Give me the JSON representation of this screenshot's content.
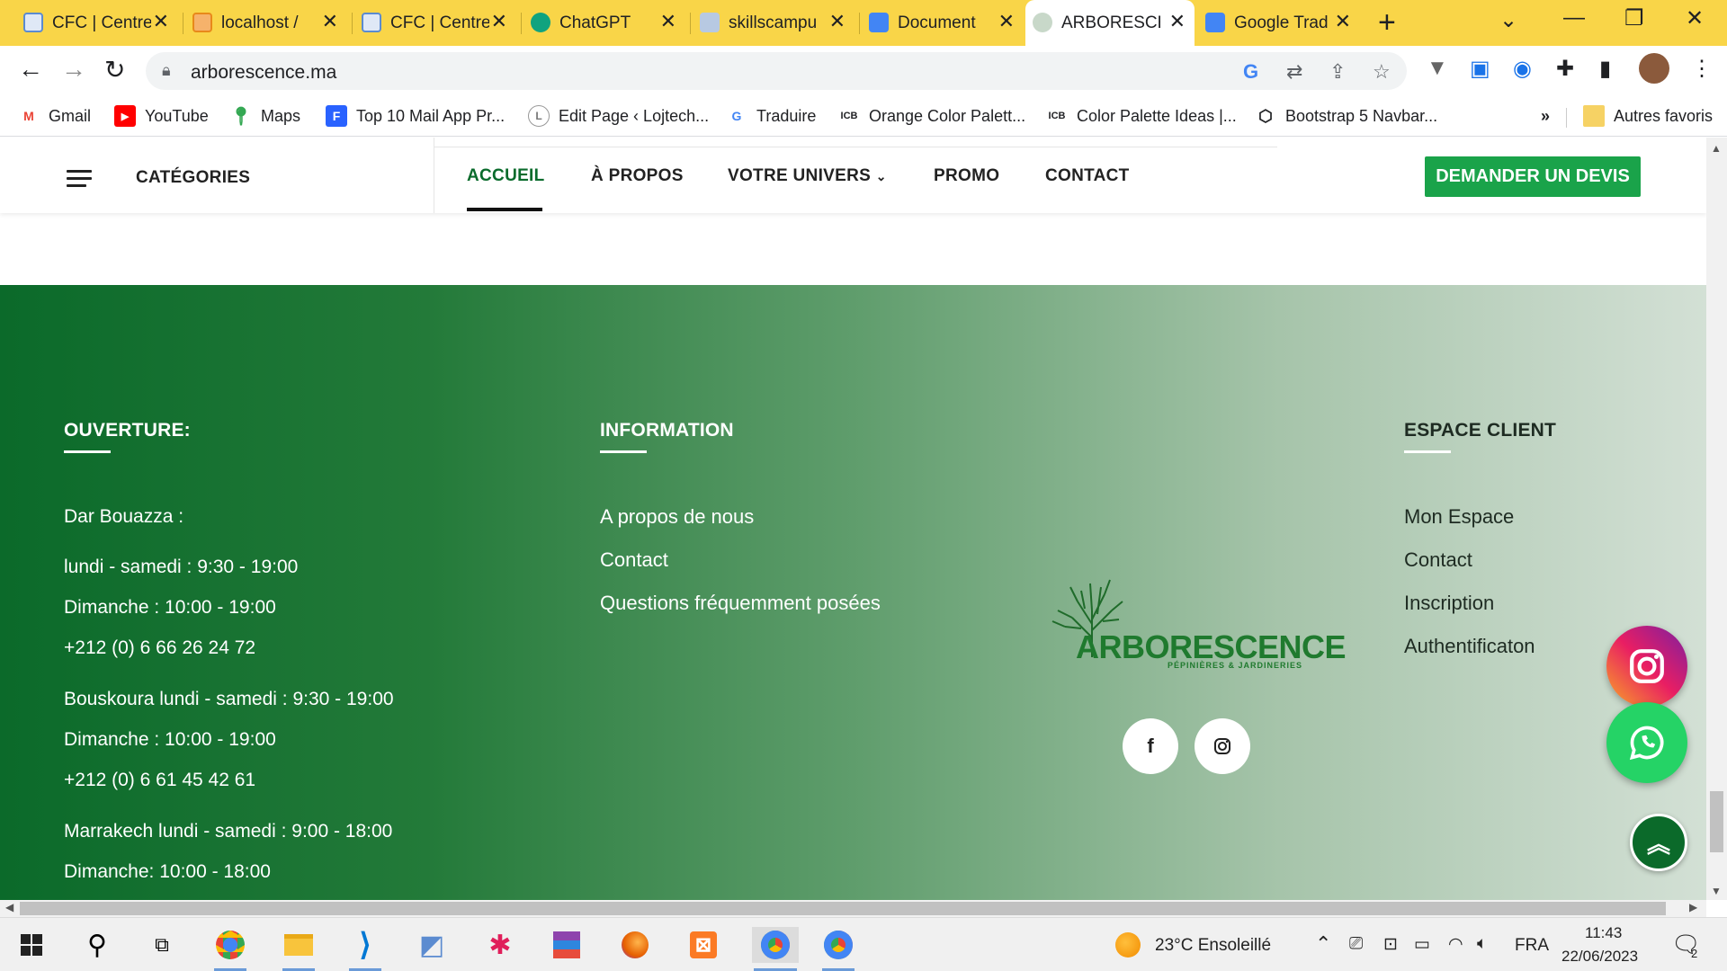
{
  "browser": {
    "tabs": [
      {
        "title": "CFC | Centre",
        "favicon_color": "#5b8bd0"
      },
      {
        "title": "localhost / ",
        "favicon_color": "#e8891a"
      },
      {
        "title": "CFC | Centre",
        "favicon_color": "#5b8bd0"
      },
      {
        "title": "ChatGPT",
        "favicon_color": "#10a37f"
      },
      {
        "title": "skillscampu",
        "favicon_color": "#4a6fa5"
      },
      {
        "title": "Document",
        "favicon_color": "#4285f4"
      },
      {
        "title": "ARBORESCE",
        "favicon_color": "#6a8e6f"
      },
      {
        "title": "Google Trad",
        "favicon_color": "#4285f4"
      }
    ],
    "active_tab_index": 6,
    "url": "arborescence.ma",
    "bookmarks": [
      {
        "label": "Gmail",
        "icon": "M",
        "color": "#ea4335"
      },
      {
        "label": "YouTube",
        "icon": "▶",
        "color": "#ff0000"
      },
      {
        "label": "Maps",
        "icon": "●",
        "color": "#34a853"
      },
      {
        "label": "Top 10 Mail App Pr...",
        "icon": "F",
        "color": "#2962ff"
      },
      {
        "label": "Edit Page ‹ Lojtech...",
        "icon": "L",
        "color": "#7a7a7a"
      },
      {
        "label": "Traduire",
        "icon": "G",
        "color": "#4285f4"
      },
      {
        "label": "Orange Color Palett...",
        "icon": "ICB",
        "color": "#111111"
      },
      {
        "label": "Color Palette Ideas |...",
        "icon": "ICB",
        "color": "#111111"
      },
      {
        "label": "Bootstrap 5 Navbar...",
        "icon": "⬡",
        "color": "#111111"
      }
    ],
    "overflow_label": "»",
    "other_bookmarks": "Autres favoris"
  },
  "site": {
    "categories_label": "CATÉGORIES",
    "menu": [
      "ACCUEIL",
      "À PROPOS",
      "VOTRE UNIVERS",
      "PROMO",
      "CONTACT"
    ],
    "cta": "DEMANDER UN DEVIS",
    "brand_color": "#1aa34a"
  },
  "footer": {
    "ouverture": {
      "heading": "OUVERTURE:",
      "lines": [
        "Dar Bouazza :",
        "lundi - samedi : 9:30 - 19:00",
        "Dimanche : 10:00 - 19:00",
        "+212 (0) 6 66 26 24 72",
        "Bouskoura lundi - samedi : 9:30 - 19:00",
        "Dimanche : 10:00 - 19:00",
        "+212 (0) 6 61 45 42 61",
        "Marrakech lundi - samedi : 9:00 - 18:00",
        "Dimanche: 10:00 - 18:00"
      ]
    },
    "information": {
      "heading": "INFORMATION",
      "links": [
        "A propos de nous",
        "Contact",
        "Questions fréquemment posées"
      ]
    },
    "logo": {
      "name": "ARBORESCENCE",
      "tagline": "PÉPINIÈRES & JARDINERIES"
    },
    "espace_client": {
      "heading": "ESPACE CLIENT",
      "links": [
        "Mon Espace",
        "Contact",
        "Inscription",
        "Authentificaton"
      ]
    }
  },
  "taskbar": {
    "weather": "23°C  Ensoleillé",
    "language": "FRA",
    "time": "11:43",
    "date": "22/06/2023",
    "notifications": "2"
  }
}
